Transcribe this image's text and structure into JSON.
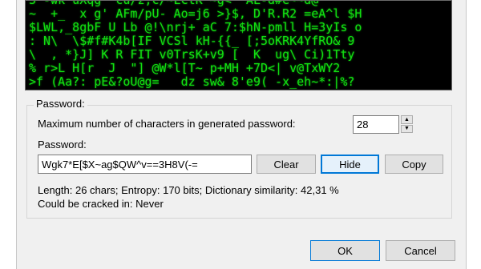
{
  "matrix_lines": [
    "3 -wk uXqg` cu/z,c/~ECtK ~g< `AL-d#e~~d@ ",
    "~  +_  x g' AFm/pU- Ao=j6 >}$, D'R.R2 =eA^l $H",
    "$LWL,_8gbF U Lb @!\\nrj+ aC 7:$hN-pmll H=3yIs o",
    ": N\\  \\$#f#K4b[IF VCSl kH-{{_ [;5oKRK4YfRO& 9",
    "\\  , *}J] K R FIT v0TrsK+v9 [  K  ug\\ Ci)1Tty",
    "% r>L H[r  J  \"] @W*l[T~ p+MH +7D<| v@TxWY2",
    ">f (Aa?: pE&?oU@g=   dz sw& 8'e9( -x_eh~*:|%?"
  ],
  "password_group": {
    "title": "Password:",
    "max_chars_label": "Maximum number of characters in generated password:",
    "max_chars_value": "28",
    "password_label": "Password:",
    "password_value": "Wgk7*E[$X~ag$QW^v==3H8V(-=",
    "clear_label": "Clear",
    "hide_label": "Hide",
    "copy_label": "Copy",
    "stats_text": "Length: 26 chars; Entropy: 170 bits; Dictionary similarity: 42,31 %",
    "crack_text": "Could be cracked in:  Never"
  },
  "dialog": {
    "ok_label": "OK",
    "cancel_label": "Cancel"
  },
  "icons": {
    "spin_up": "triangle-up",
    "spin_down": "triangle-down"
  },
  "colors": {
    "matrix_text": "#12e012",
    "matrix_bg": "#000000",
    "focus": "#0078d7"
  }
}
